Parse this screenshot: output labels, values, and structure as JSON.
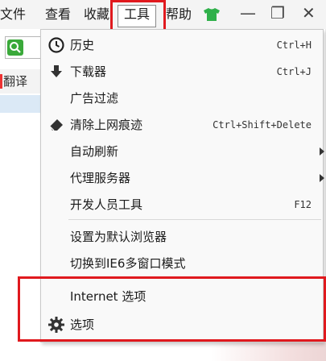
{
  "menubar": {
    "items": [
      {
        "label": "文件"
      },
      {
        "label": "查看"
      },
      {
        "label": "收藏"
      },
      {
        "label": "工具"
      },
      {
        "label": "帮助"
      }
    ],
    "window_controls": {
      "minimize": "—",
      "restore": "❐",
      "close": "✕"
    }
  },
  "background": {
    "translate_label": "翻译"
  },
  "tools_menu": {
    "items": [
      {
        "label": "历史",
        "shortcut": "Ctrl+H",
        "icon": "clock-icon"
      },
      {
        "label": "下载器",
        "shortcut": "Ctrl+J",
        "icon": "download-arrow-icon"
      },
      {
        "label": "广告过滤",
        "shortcut": ""
      },
      {
        "label": "清除上网痕迹",
        "shortcut": "Ctrl+Shift+Delete",
        "icon": "eraser-icon"
      },
      {
        "label": "自动刷新",
        "submenu": true
      },
      {
        "label": "代理服务器",
        "submenu": true
      },
      {
        "label": "开发人员工具",
        "shortcut": "F12"
      },
      {
        "label": "设置为默认浏览器"
      },
      {
        "label": "切换到IE6多窗口模式"
      },
      {
        "label": "Internet 选项"
      },
      {
        "label": "选项",
        "icon": "gear-icon"
      }
    ]
  },
  "colors": {
    "highlight_red": "#e0191e",
    "search_green": "#3aa93a",
    "tshirt_green": "#2fb04a"
  }
}
